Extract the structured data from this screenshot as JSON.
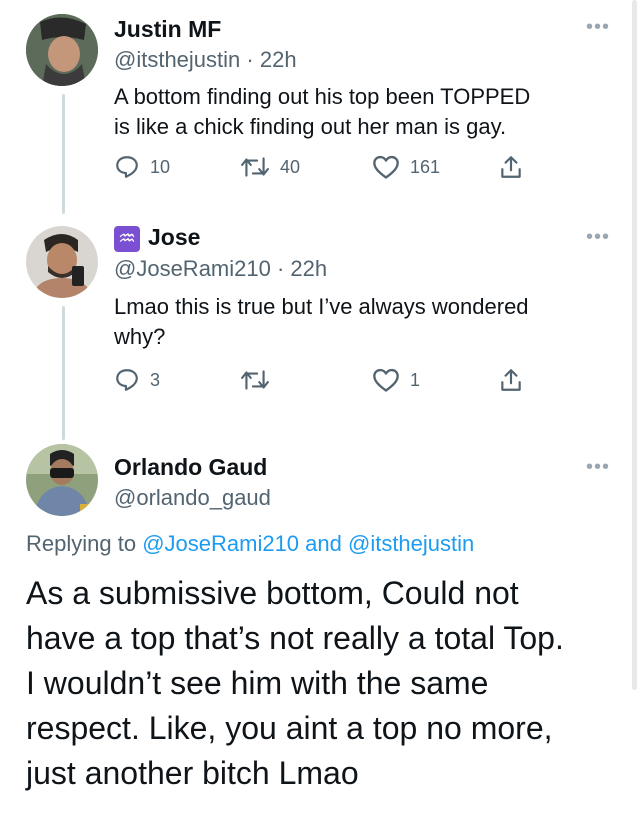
{
  "tweet1": {
    "name": "Justin MF",
    "handle": "@itsthejustin",
    "time": "· 22h",
    "text_line1": "A bottom finding out his top been TOPPED",
    "text_line2": "is like a chick finding out her man is gay.",
    "replies": "10",
    "retweets": "40",
    "likes": "161",
    "more_label": "•••"
  },
  "tweet2": {
    "badge": "♒",
    "name": "Jose",
    "handle": "@JoseRami210",
    "time": "· 22h",
    "text_line1": "Lmao this is true but I’ve always wondered",
    "text_line2": "why?",
    "replies": "3",
    "retweets": "",
    "likes": "1",
    "more_label": "•••"
  },
  "tweet3": {
    "name": "Orlando Gaud",
    "handle": "@orlando_gaud",
    "replying_prefix": "Replying to ",
    "reply_user1": "@JoseRami210",
    "reply_and": " and ",
    "reply_user2": "@itsthejustin",
    "text_lines": [
      "As a submissive bottom, Could not",
      "have a top that’s not really a total Top.",
      "I wouldn’t see him with the same",
      "respect. Like, you aint a top no more,",
      "just another bitch Lmao"
    ],
    "more_label": "•••"
  },
  "colors": {
    "text": "#0f1419",
    "secondary": "#536471",
    "link": "#1d9bf0",
    "thread_line": "#cfd9de"
  },
  "icons": [
    "reply-icon",
    "retweet-icon",
    "like-icon",
    "share-icon",
    "more-icon",
    "aquarius-icon"
  ]
}
